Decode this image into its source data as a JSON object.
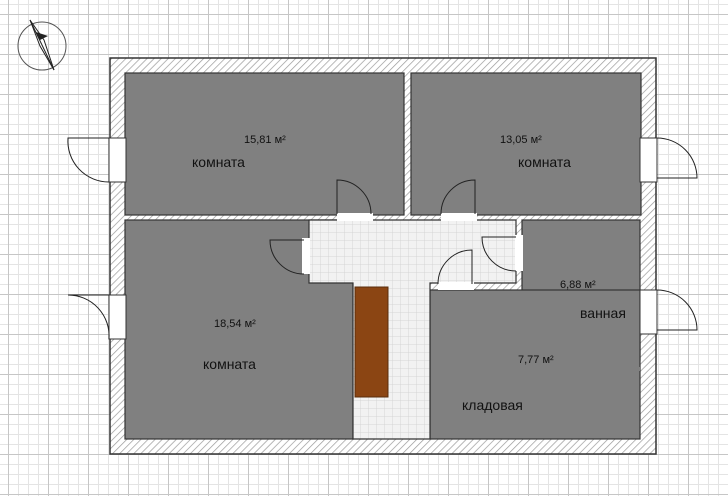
{
  "rooms": [
    {
      "name": "комната",
      "area": "15,81 м²"
    },
    {
      "name": "комната",
      "area": "13,05 м²"
    },
    {
      "name": "комната",
      "area": "18,54 м²"
    },
    {
      "name": "ванная",
      "area": "6,88 м²"
    },
    {
      "name": "кладовая",
      "area": "7,77 м²"
    }
  ],
  "compass": {
    "icon": "compass-icon"
  },
  "colors": {
    "room_fill": "#808080",
    "corridor_fill": "#ececec",
    "wall_hatch": "#9a9a9a",
    "stairs": "#8b4513"
  }
}
